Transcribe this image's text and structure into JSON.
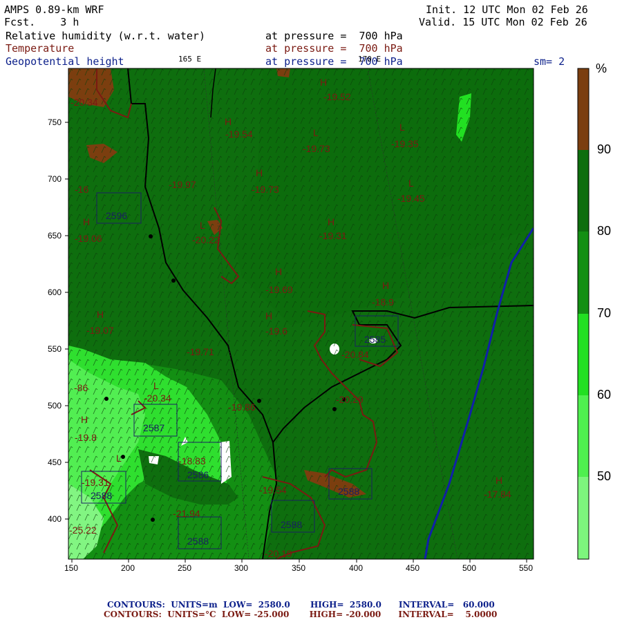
{
  "header": {
    "model": "AMPS 0.89-km WRF",
    "fcst": "Fcst.    3 h",
    "init": "Init. 12 UTC Mon 02 Feb 26",
    "valid": "Valid. 15 UTC Mon 02 Feb 26",
    "rh_label": "Relative humidity (w.r.t. water)",
    "rh_level": "at pressure =  700 hPa",
    "t_label": "Temperature",
    "t_level": "at pressure =  700 hPa",
    "z_label": "Geopotential height",
    "z_level": "at pressure =  700 hPa",
    "lon_left": "165 E",
    "lon_right": "170 E",
    "smoothing": "sm= 2"
  },
  "axes": {
    "x_ticks": [
      "150",
      "200",
      "250",
      "300",
      "350",
      "400",
      "450",
      "500",
      "550"
    ],
    "y_ticks": [
      "750",
      "700",
      "650",
      "600",
      "550",
      "500",
      "450",
      "400"
    ]
  },
  "colorbar": {
    "unit": "%",
    "labels": [
      "90",
      "80",
      "70",
      "60",
      "50"
    ],
    "colors": [
      "#7b3e0f",
      "#0e6e0e",
      "#0f7f0f",
      "#22e022",
      "#4ff04f",
      "#7df57d"
    ]
  },
  "map_labels": {
    "height_boxes": [
      "2596",
      "2587",
      "2586",
      "2588",
      "2588",
      "2588",
      "2588",
      "2585"
    ],
    "temperatures": [
      "-20.34",
      "-19.54",
      "-19.73",
      "-19.35",
      "-19.97",
      "-19.73",
      "-19.45",
      "-19.06",
      "-20.22",
      "-19.31",
      "-19.69",
      "-18.9",
      "-19.07",
      "-19.71",
      "-19.6",
      "-20.84",
      "-20.34",
      "-19.8",
      "-18.83",
      "-19.31",
      "-19.54",
      "-21.94",
      "-25.22",
      "-20.19",
      "-17.84",
      "-19.52",
      "-16",
      "-86",
      "-19.86",
      "-20.29"
    ],
    "h_marks": [
      "H",
      "H",
      "H",
      "H",
      "H",
      "H",
      "H",
      "H",
      "H",
      "H",
      "H"
    ],
    "l_marks": [
      "L",
      "L",
      "L",
      "L",
      "L",
      "L"
    ]
  },
  "footer": {
    "z_line": "CONTOURS:  UNITS=m  LOW=  2580.0       HIGH=  2580.0      INTERVAL=   60.000",
    "t_line": "CONTOURS:  UNITS=°C  LOW= -25.000       HIGH= -20.000      INTERVAL=    5.0000"
  }
}
